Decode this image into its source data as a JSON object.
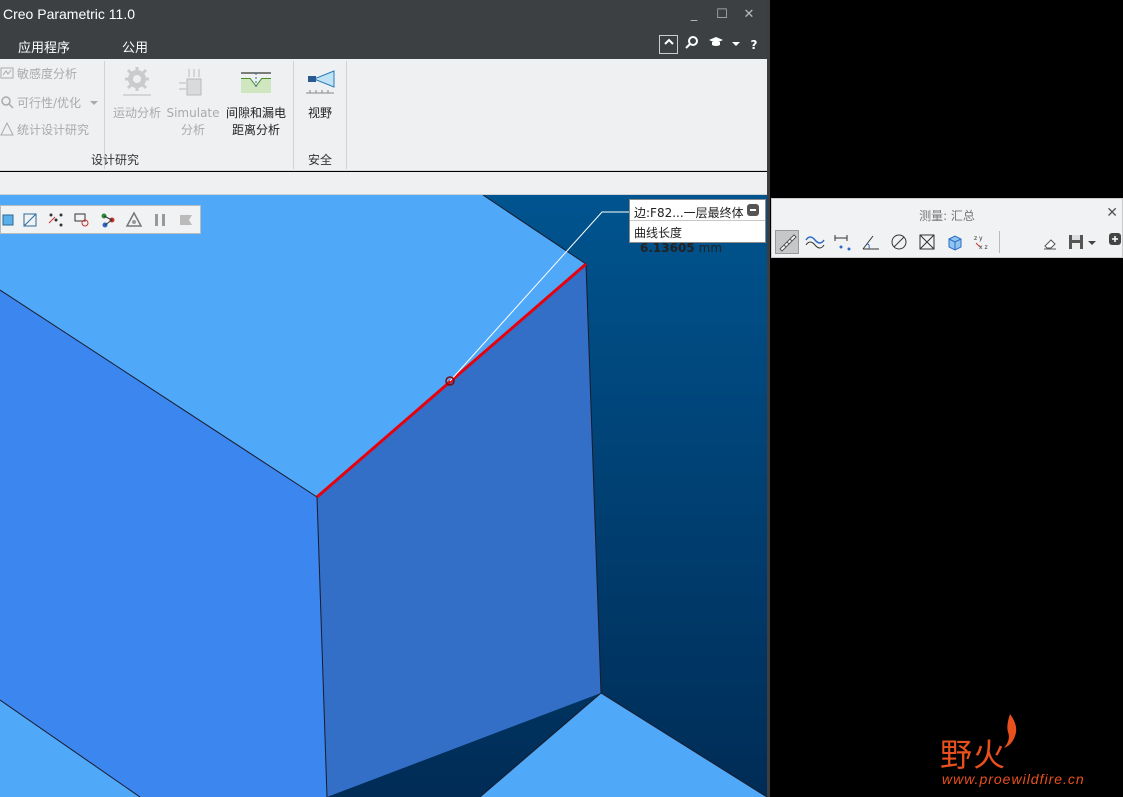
{
  "window": {
    "title": "Creo Parametric 11.0",
    "controls": [
      "_",
      "☐",
      "✕"
    ]
  },
  "menubar": {
    "items": [
      "应用程序",
      "公用"
    ],
    "help_label": "?"
  },
  "ribbon": {
    "small_buttons": [
      "敏感度分析",
      "可行性/优化",
      "统计设计研究"
    ],
    "motion_analysis": "运动分析",
    "simulate_line1": "Simulate",
    "simulate_line2": "分析",
    "clearance_line1": "间隙和漏电",
    "clearance_line2": "距离分析",
    "view": "视野",
    "group_design_study": "设计研究",
    "group_safety": "安全"
  },
  "callout": {
    "edge_label": "边:F82...一层最终体",
    "metric_label": "曲线长度",
    "value": "6.13605",
    "unit": "mm"
  },
  "measure_panel": {
    "title": "测量: 汇总",
    "close": "✕"
  },
  "watermark": {
    "brand": "野火",
    "url": "www.proewildfire.cn"
  },
  "colors": {
    "face_top": "#4fa8f8",
    "face_left": "#3c86ef",
    "face_right": "#336fc7",
    "background_dark": "#003f77",
    "highlight_edge": "#e8000d"
  }
}
